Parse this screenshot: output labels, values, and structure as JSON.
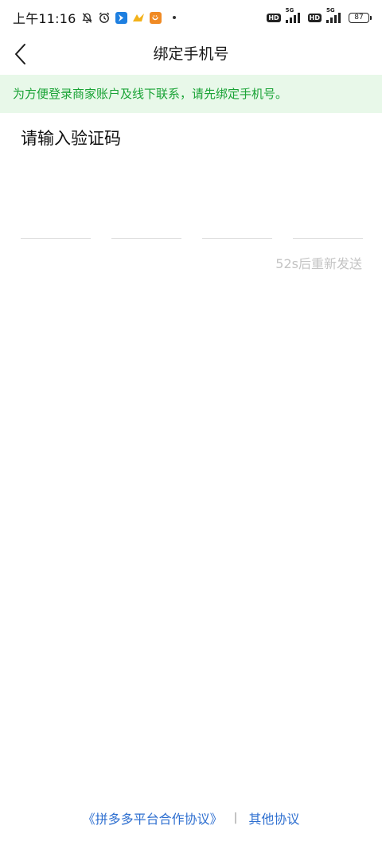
{
  "status_bar": {
    "time": "上午11:16",
    "network_labels": [
      "HD",
      "5G",
      "HD",
      "5G"
    ],
    "battery_level": "87"
  },
  "nav": {
    "title": "绑定手机号"
  },
  "notice": {
    "text": "为方便登录商家账户及线下联系，请先绑定手机号。"
  },
  "verification": {
    "prompt": "请输入验证码",
    "code_length": 4,
    "resend_text": "52s后重新发送"
  },
  "footer": {
    "agreement_link": "《拼多多平台合作协议》",
    "separator": "|",
    "other_link": "其他协议"
  },
  "colors": {
    "accent_green": "#1aa336",
    "notice_bg": "#e8f8e9",
    "link_blue": "#2e6fd0",
    "muted": "#c4c4c4"
  }
}
